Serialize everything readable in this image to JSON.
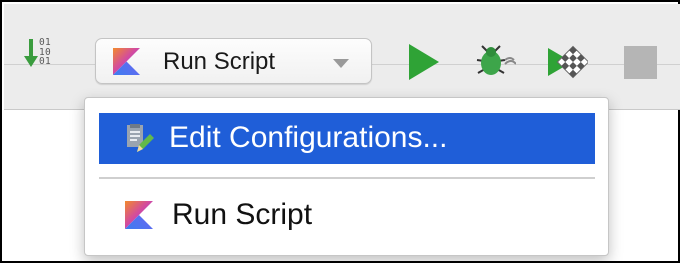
{
  "toolbar": {
    "sorter_bits": [
      "01",
      "10",
      "01"
    ],
    "run_config_label": "Run Script",
    "buttons": {
      "run": "play-icon",
      "debug": "bug-icon",
      "coverage": "coverage-icon",
      "stop": "stop-icon"
    }
  },
  "popup": {
    "items": [
      {
        "label": "Edit Configurations...",
        "icon": "edit-configurations-icon",
        "selected": true
      },
      {
        "label": "Run Script",
        "icon": "kotlin-icon",
        "selected": false
      }
    ]
  },
  "colors": {
    "selection": "#1f5ed8",
    "run_green": "#2fa336",
    "kotlin_blue": "#3b7ef0",
    "kotlin_orange": "#f28a2c",
    "toolbar_bg": "#ececec"
  }
}
